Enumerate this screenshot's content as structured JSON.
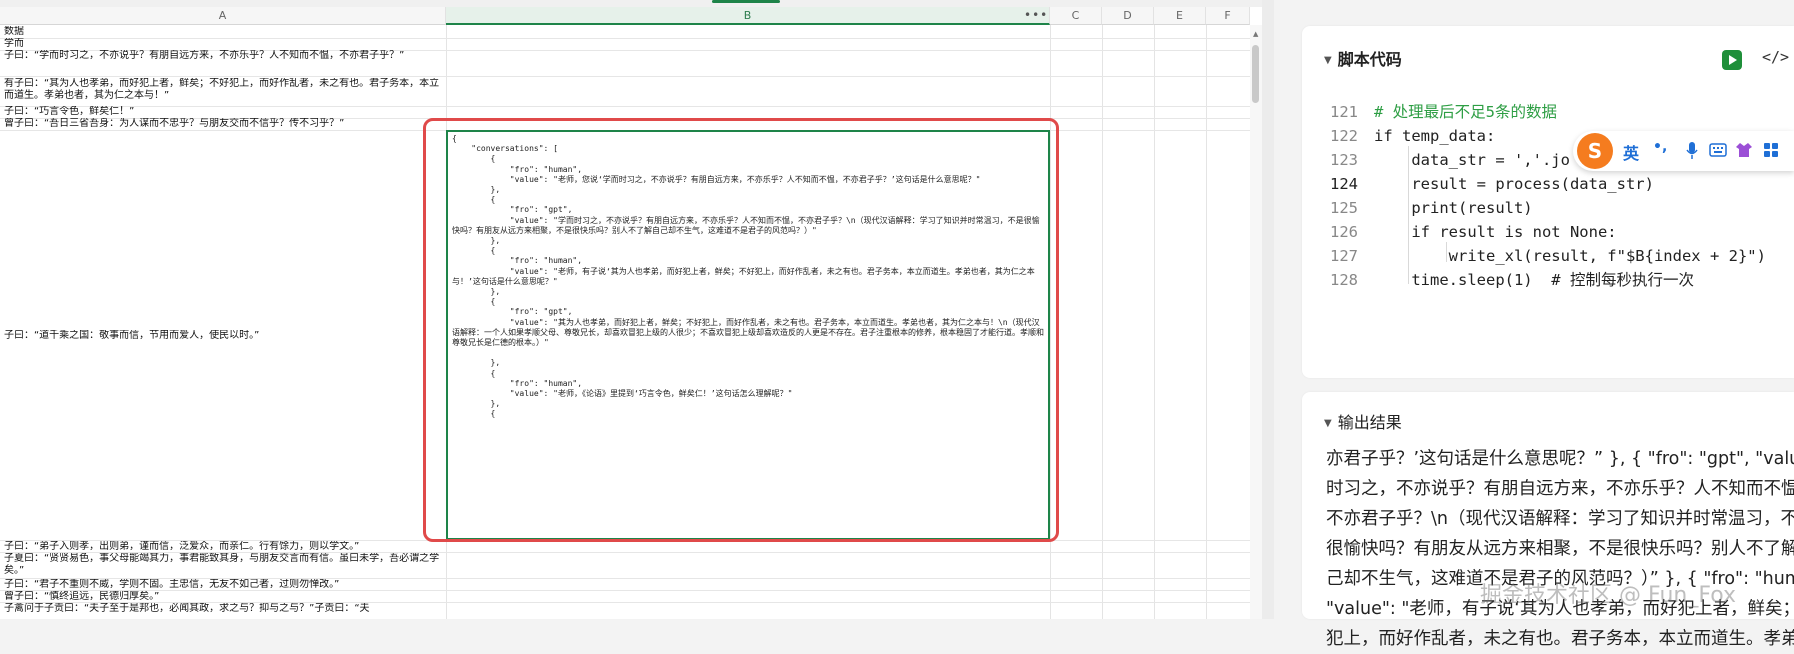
{
  "columns": [
    "A",
    "B",
    "C",
    "D",
    "E",
    "F"
  ],
  "col_more": "•••",
  "rows": [
    "数据",
    "学而",
    "子曰：“学而时习之，不亦说乎？有朋自远方来，不亦乐乎？人不知而不愠，不亦君子乎？”",
    "有子曰：“其为人也孝弟，而好犯上者，鲜矣；不好犯上，而好作乱者，未之有也。君子务本，本立而道生。孝弟也者，其为仁之本与！”",
    "子曰：“巧言令色，鲜矣仁！”",
    "曾子曰：“吾日三省吾身：为人谋而不忠乎？与朋友交而不信乎？传不习乎？”",
    "子曰：“道千乘之国：敬事而信，节用而爱人，使民以时。”",
    "子曰：“弟子入则孝，出则弟，谨而信，泛爱众，而亲仁。行有馀力，则以学文。”",
    "子夏曰：“贤贤易色，事父母能竭其力，事君能致其身，与朋友交言而有信。虽曰未学，吾必谓之学矣。”",
    "子曰：“君子不重则不威，学则不固。主忠信，无友不如己者，过则勿惮改。”",
    "曾子曰：“慎终追远，民德归厚矣。”",
    "子禽问于子贡曰：“夫子至于是邦也，必闻其政，求之与？抑与之与？”子贡曰：“夫"
  ],
  "json_cell": "{\n    \"conversations\": [\n        {\n            \"fro\": \"human\",\n            \"value\": \"老师，您说‘学而时习之，不亦说乎？有朋自远方来，不亦乐乎？人不知而不愠，不亦君子乎？’这句话是什么意思呢？\"\n        },\n        {\n            \"fro\": \"gpt\",\n            \"value\": \"学而时习之，不亦说乎？有朋自远方来，不亦乐乎？人不知而不愠，不亦君子乎？\\n（现代汉语解释：学习了知识并时常温习，不是很愉快吗？有朋友从远方来相聚，不是很快乐吗？别人不了解自己却不生气，这难道不是君子的风范吗？）\"\n        },\n        {\n            \"fro\": \"human\",\n            \"value\": \"老师，有子说‘其为人也孝弟，而好犯上者，鲜矣；不好犯上，而好作乱者，未之有也。君子务本，本立而道生。孝弟也者，其为仁之本与！’这句话是什么意思呢？\"\n        },\n        {\n            \"fro\": \"gpt\",\n            \"value\": \"其为人也孝弟，而好犯上者，鲜矣；不好犯上，而好作乱者，未之有也。君子务本，本立而道生。孝弟也者，其为仁之本与！\\n（现代汉语解释：一个人如果孝顺父母、尊敬兄长，却喜欢冒犯上级的人很少；不喜欢冒犯上级却喜欢造反的人更是不存在。君子注重根本的修养，根本稳固了才能行道。孝顺和尊敬兄长是仁德的根本。）\"\n\n        },\n        {\n            \"fro\": \"human\",\n            \"value\": \"老师，《论语》里提到‘巧言令色，鲜矣仁！’这句话怎么理解呢？\"\n        },\n        {",
  "script_panel": {
    "title": "脚本代码",
    "lines": [
      {
        "n": "121",
        "code": "# 处理最后不足5条的数据"
      },
      {
        "n": "122",
        "code": "if temp_data:"
      },
      {
        "n": "123",
        "code": "    data_str = ','.jo"
      },
      {
        "n": "124",
        "code": "    result = process(data_str)"
      },
      {
        "n": "125",
        "code": "    print(result)"
      },
      {
        "n": "126",
        "code": "    if result is not None:"
      },
      {
        "n": "127",
        "code": "        write_xl(result, f\"$B{index + 2}\")"
      },
      {
        "n": "128",
        "code": "    time.sleep(1)  # 控制每秒执行一次"
      }
    ]
  },
  "ime": {
    "logo": "S",
    "lang": "英",
    "punct": "•,"
  },
  "output_panel": {
    "title": "输出结果",
    "lines": [
      "亦君子乎？’这句话是什么意思呢？” }, { \"fro\": \"gpt\", \"value\": \"学而",
      "时习之，不亦说乎？有朋自远方来，不亦乐乎？人不知而不愠，",
      "不亦君子乎？\\n（现代汉语解释：学习了知识并时常温习，不是",
      "很愉快吗？有朋友从远方来相聚，不是很快乐吗？别人不了解自",
      "己却不生气，这难道不是君子的风范吗？）” }, { \"fro\": \"human\",",
      "\"value\": \"老师，有子说‘其为人也孝弟，而好犯上者，鲜矣；不好",
      "犯上，而好作乱者，未之有也。君子务本，本立而道生。孝弟"
    ]
  },
  "watermark": "掘金技术社区 @ Fun_Fox",
  "colors": {
    "accent": "#1e8449",
    "highlight_box": "#e04a4a",
    "run_button": "#1f8f3a",
    "comment": "#2e9e44",
    "keyword": "#1f55c8"
  }
}
